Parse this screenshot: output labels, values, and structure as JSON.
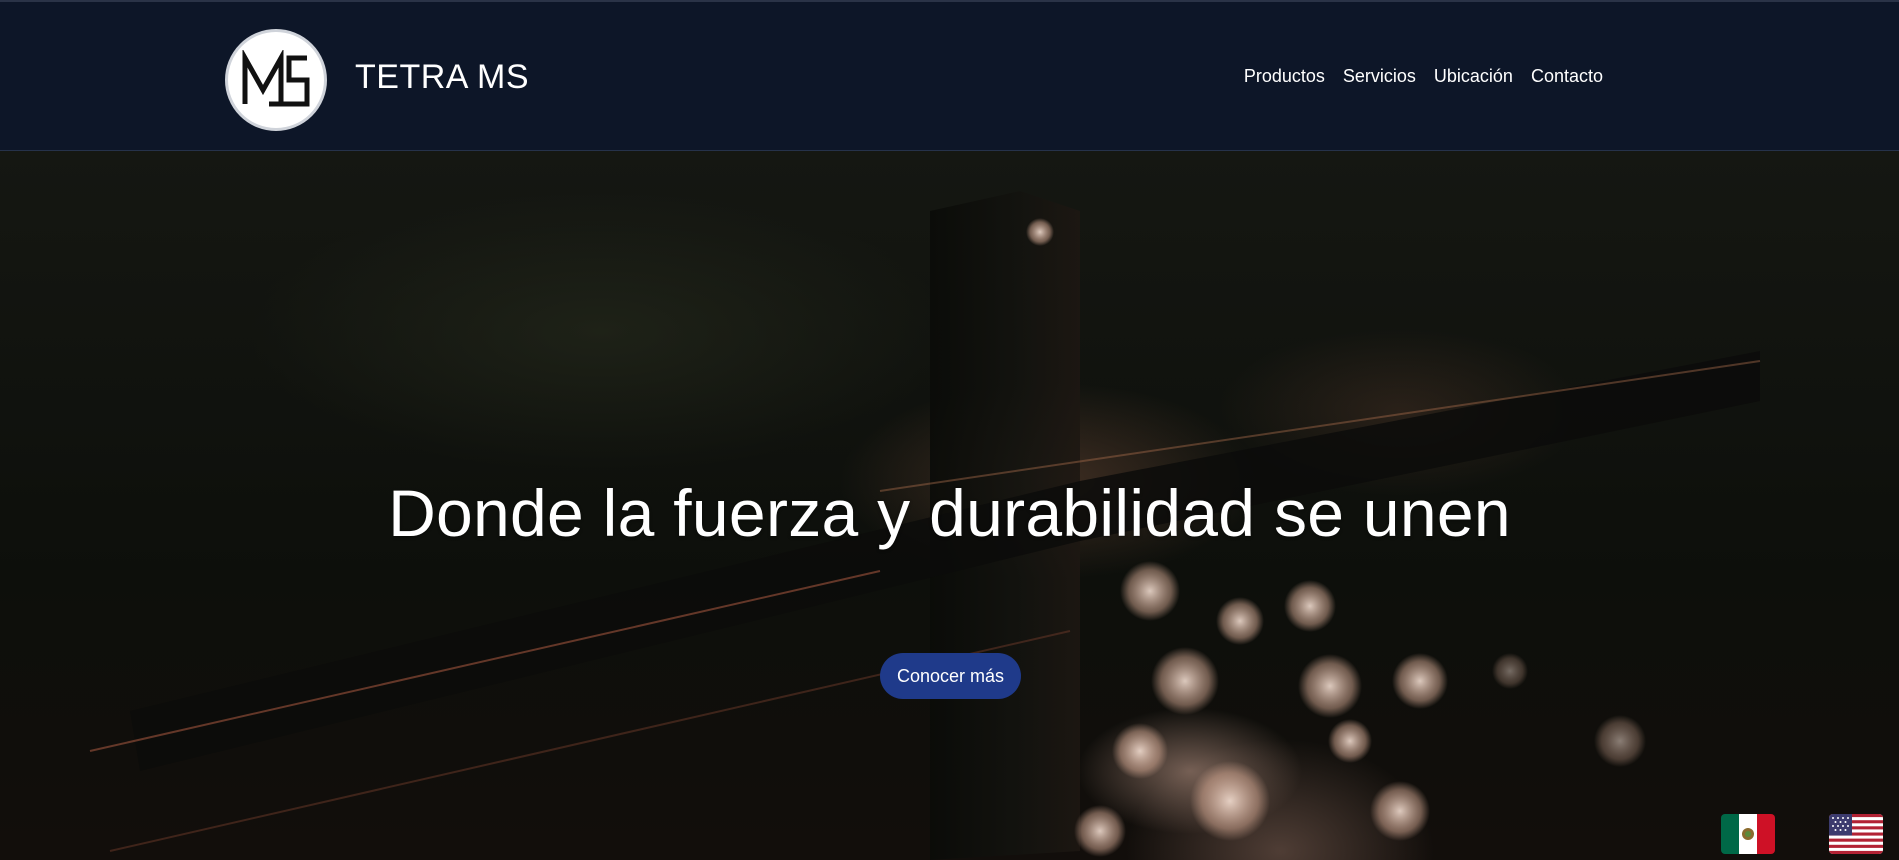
{
  "header": {
    "brand": "TETRA MS",
    "logo_text": "MS",
    "nav": [
      "Productos",
      "Servicios",
      "Ubicación",
      "Contacto"
    ]
  },
  "hero": {
    "title": "Donde la fuerza y durabilidad se unen",
    "cta_label": "Conocer más"
  },
  "language_flags": [
    {
      "icon": "mexico-flag-icon",
      "lang": "es"
    },
    {
      "icon": "usa-flag-icon",
      "lang": "en"
    }
  ],
  "colors": {
    "navbar": "#0d1628",
    "cta": "#1f3a8a",
    "text": "#ffffff"
  }
}
